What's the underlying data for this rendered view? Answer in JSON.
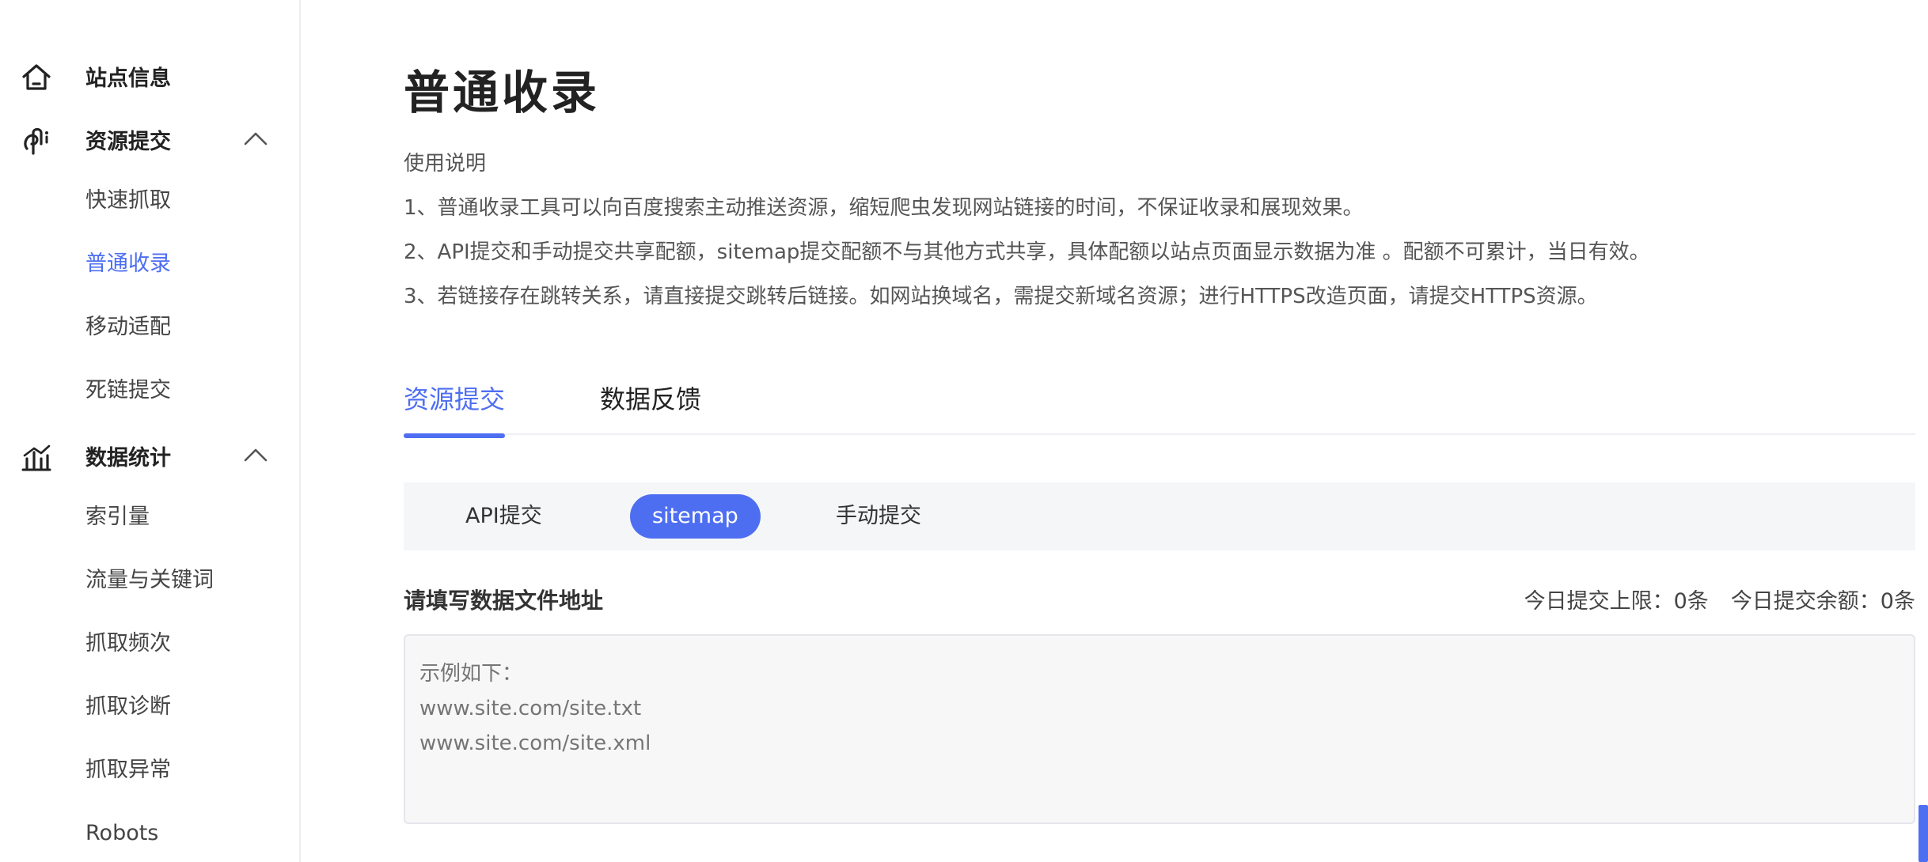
{
  "sidebar": {
    "groups": [
      {
        "label": "站点信息",
        "icon": "home-icon",
        "expanded": null
      },
      {
        "label": "资源提交",
        "icon": "submit-icon",
        "expanded": true
      },
      {
        "label": "数据统计",
        "icon": "chart-icon",
        "expanded": true
      }
    ],
    "resource_items": [
      "快速抓取",
      "普通收录",
      "移动适配",
      "死链提交"
    ],
    "stats_items": [
      "索引量",
      "流量与关键词",
      "抓取频次",
      "抓取诊断",
      "抓取异常",
      "Robots"
    ],
    "active_item": "普通收录"
  },
  "main": {
    "title": "普通收录",
    "help_title": "使用说明",
    "help_lines": [
      "1、普通收录工具可以向百度搜索主动推送资源，缩短爬虫发现网站链接的时间，不保证收录和展现效果。",
      "2、API提交和手动提交共享配额，sitemap提交配额不与其他方式共享，具体配额以站点页面显示数据为准 。配额不可累计，当日有效。",
      "3、若链接存在跳转关系，请直接提交跳转后链接。如网站换域名，需提交新域名资源；进行HTTPS改造页面，请提交HTTPS资源。"
    ],
    "tabs": [
      {
        "label": "资源提交",
        "active": true
      },
      {
        "label": "数据反馈",
        "active": false
      }
    ],
    "subtabs": [
      {
        "label": "API提交",
        "active": false
      },
      {
        "label": "sitemap",
        "active": true
      },
      {
        "label": "手动提交",
        "active": false
      }
    ],
    "field_label": "请填写数据文件地址",
    "quota_limit": "今日提交上限：0条",
    "quota_remaining": "今日提交余额：0条",
    "textarea_placeholder": "示例如下：\nwww.site.com/site.txt\nwww.site.com/site.xml"
  },
  "colors": {
    "accent": "#4e6ef2",
    "text": "#333333",
    "muted": "#999999",
    "subbar_bg": "#f5f6f8"
  }
}
